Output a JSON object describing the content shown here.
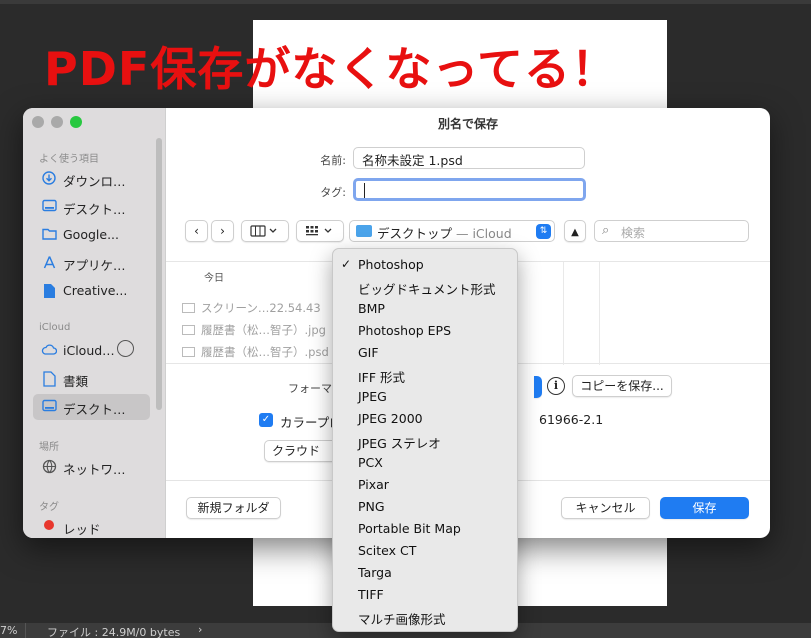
{
  "annotation": "PDF保存がなくなってる！",
  "ps_status": {
    "zoom": "7%",
    "info": "ファイル : 24.9M/0 bytes",
    "arrow": "›"
  },
  "dialog": {
    "title": "別名で保存",
    "name_label": "名前:",
    "name_value": "名称未設定 1.psd",
    "tag_label": "タグ:",
    "tag_value": "",
    "location": "デスクトップ",
    "location_sub": " — iCloud",
    "search_placeholder": "検索",
    "column_header": "今日",
    "files": [
      "スクリーン…22.54.43",
      "履歴書（松…智子）.jpg",
      "履歴書（松…智子）.psd"
    ],
    "format_label": "フォーマット",
    "copy_save_button": "コピーを保存...",
    "color_profile_label": "カラープロ",
    "color_profile_value": "61966-2.1",
    "cloud_button": "クラウド",
    "new_folder_button": "新規フォルダ",
    "cancel_button": "キャンセル",
    "save_button": "保存"
  },
  "sidebar": {
    "sections": [
      "よく使う項目",
      "iCloud",
      "場所",
      "タグ"
    ],
    "favorites": [
      {
        "label": "ダウンロ…",
        "icon": "download-icon"
      },
      {
        "label": "デスクト…",
        "icon": "desktop-icon"
      },
      {
        "label": "Google...",
        "icon": "folder-icon"
      },
      {
        "label": "アプリケ…",
        "icon": "applications-icon"
      },
      {
        "label": "Creative...",
        "icon": "document-icon"
      }
    ],
    "icloud": [
      {
        "label": "iCloud…",
        "icon": "cloud-icon"
      },
      {
        "label": "書類",
        "icon": "document-icon"
      },
      {
        "label": "デスクト…",
        "icon": "desktop-icon",
        "selected": true
      }
    ],
    "locations": [
      {
        "label": "ネットワ…",
        "icon": "network-icon"
      }
    ],
    "tags": [
      {
        "label": "レッド",
        "color": "#e8372d"
      }
    ]
  },
  "format_menu": {
    "selected": "Photoshop",
    "items": [
      "Photoshop",
      "ビッグドキュメント形式",
      "BMP",
      "Photoshop EPS",
      "GIF",
      "IFF 形式",
      "JPEG",
      "JPEG 2000",
      "JPEG ステレオ",
      "PCX",
      "Pixar",
      "PNG",
      "Portable Bit Map",
      "Scitex CT",
      "Targa",
      "TIFF",
      "マルチ画像形式"
    ]
  },
  "colors": {
    "accent": "#1f7cf2",
    "annotation_red": "#e81010",
    "menu_bg": "#e9e9e9"
  }
}
